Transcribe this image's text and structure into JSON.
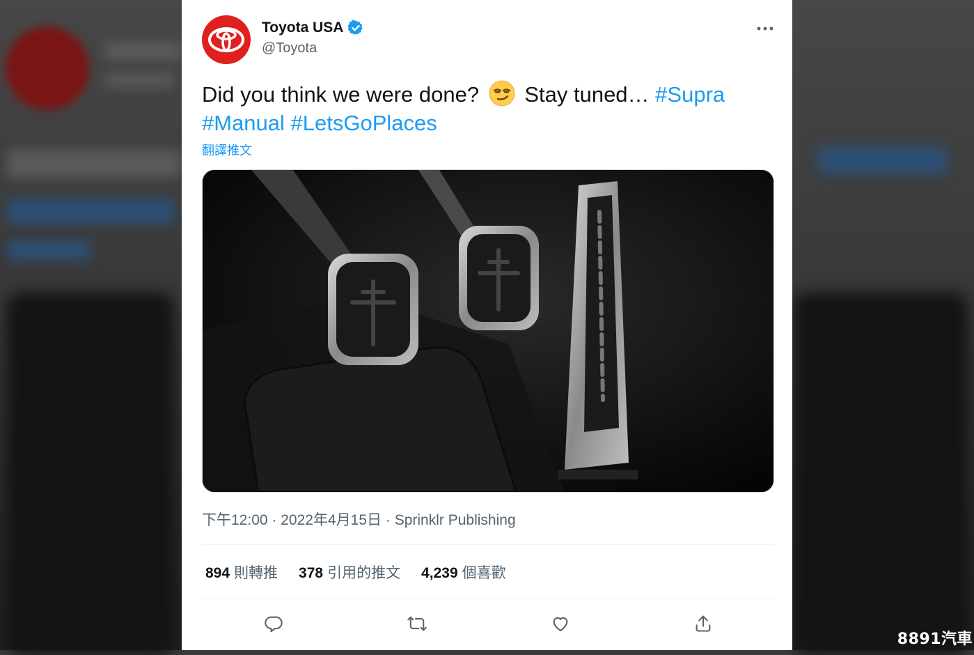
{
  "tweet": {
    "display_name": "Toyota USA",
    "handle": "@Toyota",
    "verified": true,
    "text_plain_1": "Did you think we were done?",
    "emoji": "smirking-face",
    "text_plain_2": "Stay tuned…",
    "hashtags": [
      "#Supra",
      "#Manual",
      "#LetsGoPlaces"
    ],
    "translate_label": "翻譯推文",
    "time": "下午12:00",
    "date": "2022年4月15日",
    "source": "Sprinklr Publishing",
    "separator": "·"
  },
  "stats": [
    {
      "count": "894",
      "label": "則轉推"
    },
    {
      "count": "378",
      "label": "引用的推文"
    },
    {
      "count": "4,239",
      "label": "個喜歡"
    }
  ],
  "actions": [
    "reply-icon",
    "retweet-icon",
    "like-icon",
    "share-icon"
  ],
  "colors": {
    "accent": "#1d9bf0",
    "brand_red": "#e0201f",
    "text": "#0f1419",
    "muted": "#536471"
  },
  "watermark": "8891汽車"
}
